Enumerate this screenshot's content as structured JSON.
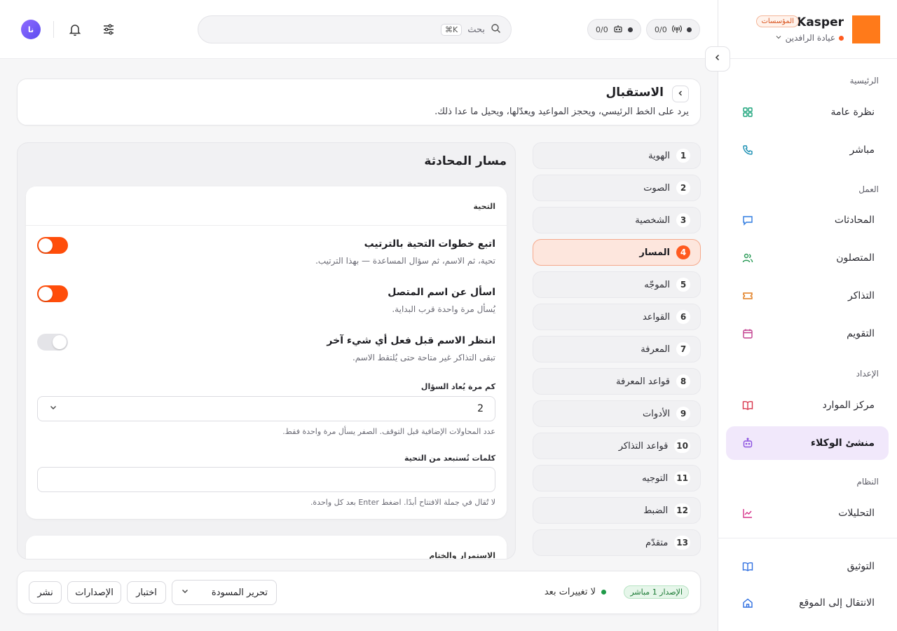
{
  "brand": {
    "name": "Kasper",
    "badge": "المؤسسات",
    "org": "عيادة الرافدين",
    "logo_color": "#ff7a1a"
  },
  "sidebar": {
    "sections": {
      "main": "الرئيسية",
      "work": "العمل",
      "setup": "الإعداد",
      "system": "النظام"
    },
    "items": [
      {
        "label": "نظرة عامة",
        "icon": "grid-icon"
      },
      {
        "label": "مباشر",
        "icon": "phone-icon"
      },
      {
        "label": "المحادثات",
        "icon": "chat-icon"
      },
      {
        "label": "المتصلون",
        "icon": "users-icon"
      },
      {
        "label": "التذاكر",
        "icon": "ticket-icon"
      },
      {
        "label": "التقويم",
        "icon": "calendar-icon"
      },
      {
        "label": "مركز الموارد",
        "icon": "book-icon"
      },
      {
        "label": "منشئ الوكلاء",
        "icon": "robot-icon"
      },
      {
        "label": "التحليلات",
        "icon": "chart-icon"
      }
    ],
    "footer": [
      {
        "label": "التوثيق",
        "icon": "docs-icon"
      },
      {
        "label": "الانتقال إلى الموقع",
        "icon": "home-icon"
      }
    ]
  },
  "topbar": {
    "counter_calls": "0/0",
    "counter_agents": "0/0",
    "search_placeholder": "بحث",
    "search_shortcut": "⌘K",
    "avatar_initials": "نا"
  },
  "page": {
    "title": "الاستقبال",
    "description": "يرد على الخط الرئيسي، ويحجز المواعيد ويعدّلها، ويحيل ما عدا ذلك."
  },
  "steps": [
    {
      "num": "1",
      "label": "الهوية"
    },
    {
      "num": "2",
      "label": "الصوت"
    },
    {
      "num": "3",
      "label": "الشخصية"
    },
    {
      "num": "4",
      "label": "المسار"
    },
    {
      "num": "5",
      "label": "الموجّه"
    },
    {
      "num": "6",
      "label": "القواعد"
    },
    {
      "num": "7",
      "label": "المعرفة"
    },
    {
      "num": "8",
      "label": "قواعد المعرفة"
    },
    {
      "num": "9",
      "label": "الأدوات"
    },
    {
      "num": "10",
      "label": "قواعد التذاكر"
    },
    {
      "num": "11",
      "label": "التوجيه"
    },
    {
      "num": "12",
      "label": "الضبط"
    },
    {
      "num": "13",
      "label": "متقدّم"
    }
  ],
  "panel": {
    "title": "مسار المحادثة",
    "greeting": {
      "header": "التحية",
      "rows": [
        {
          "title": "اتبع خطوات التحية بالترتيب",
          "desc": "تحية، ثم الاسم، ثم سؤال المساعدة — بهذا الترتيب.",
          "on": true
        },
        {
          "title": "اسأل عن اسم المتصل",
          "desc": "يُسأل مرة واحدة قرب البداية.",
          "on": true
        },
        {
          "title": "انتظر الاسم قبل فعل أي شيء آخر",
          "desc": "تبقى التذاكر غير متاحة حتى يُلتقط الاسم.",
          "on": false
        }
      ],
      "retry_label": "كم مرة يُعاد السؤال",
      "retry_value": "2",
      "retry_hint": "عدد المحاولات الإضافية قبل التوقف. الصفر يسأل مرة واحدة فقط.",
      "exclude_label": "كلمات تُستبعد من التحية",
      "exclude_value": "",
      "exclude_hint": "لا تُقال في جملة الافتتاح أبدًا. اضغط Enter بعد كل واحدة."
    },
    "continuation_header": "الاستمرار والختام"
  },
  "bottombar": {
    "live_badge": "الإصدار 1 مباشر",
    "status": "لا تغييرات بعد",
    "mode_select": "تحرير المسودة",
    "test_label": "اختبار",
    "versions_label": "الإصدارات",
    "publish_label": "نشر"
  },
  "colors": {
    "accent": "#ff4d0a",
    "active_nav": "#f1e8fb",
    "live": "#1f9a48"
  }
}
